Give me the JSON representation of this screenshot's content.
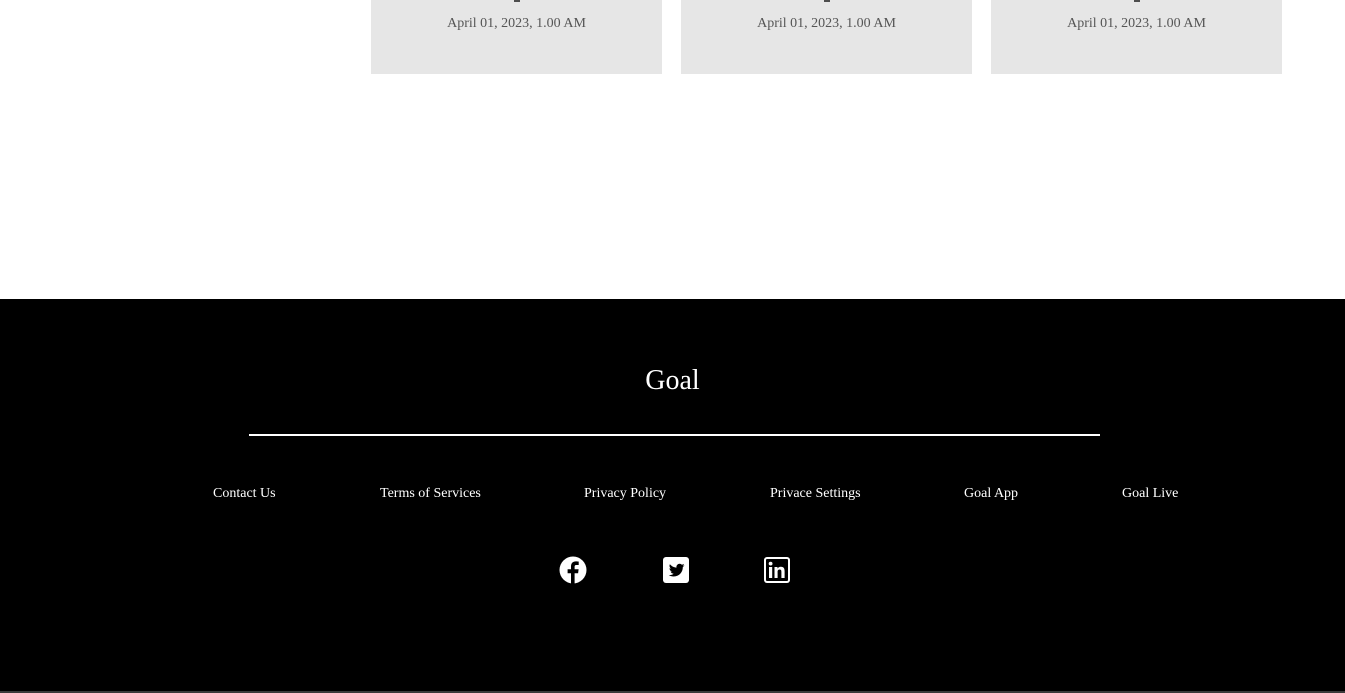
{
  "cards": [
    {
      "date": "April 01, 2023, 1.00 AM"
    },
    {
      "date": "April 01, 2023, 1.00 AM"
    },
    {
      "date": "April 01, 2023, 1.00 AM"
    }
  ],
  "footer": {
    "brand": "Goal",
    "links": [
      {
        "label": "Contact Us"
      },
      {
        "label": "Terms of Services"
      },
      {
        "label": "Privacy Policy"
      },
      {
        "label": "Privace Settings"
      },
      {
        "label": "Goal App"
      },
      {
        "label": "Goal Live"
      }
    ],
    "social": [
      {
        "icon": "facebook-icon"
      },
      {
        "icon": "twitter-icon"
      },
      {
        "icon": "linkedin-icon"
      }
    ]
  },
  "colors": {
    "card_bg": "#e6e6e6",
    "footer_bg": "#000000",
    "footer_text": "#ffffff",
    "date_text": "#555555"
  }
}
